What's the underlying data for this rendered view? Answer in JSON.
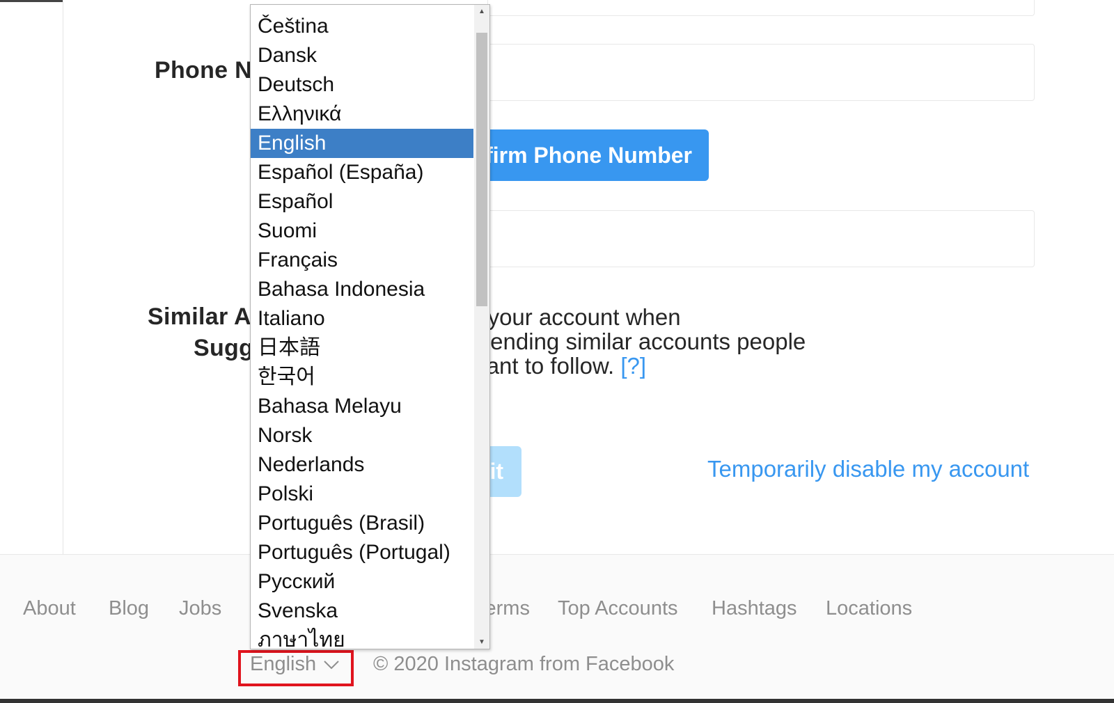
{
  "form": {
    "phone_label": "Phone Number",
    "confirm_phone_button": "Confirm Phone Number",
    "similar_label_line1": "Similar Account",
    "similar_label_line2": "Suggestions",
    "similar_description": "Include your account when recommending similar accounts people might want to follow.",
    "help_link": "[?]",
    "submit_button": "Submit",
    "disable_link": "Temporarily disable my account"
  },
  "footer": {
    "links": [
      "About",
      "Blog",
      "Jobs",
      "Terms",
      "Top Accounts",
      "Hashtags",
      "Locations"
    ],
    "language_selected": "English",
    "copyright": "© 2020 Instagram from Facebook"
  },
  "language_dropdown": {
    "selected": "English",
    "options": [
      "Čeština",
      "Dansk",
      "Deutsch",
      "Ελληνικά",
      "English",
      "Español (España)",
      "Español",
      "Suomi",
      "Français",
      "Bahasa Indonesia",
      "Italiano",
      "日本語",
      "한국어",
      "Bahasa Melayu",
      "Norsk",
      "Nederlands",
      "Polski",
      "Português (Brasil)",
      "Português (Portugal)",
      "Русский",
      "Svenska",
      "ภาษาไทย"
    ]
  },
  "colors": {
    "accent": "#3897f0",
    "highlight": "#3d7fc6",
    "annotation_box": "#e0141e"
  }
}
